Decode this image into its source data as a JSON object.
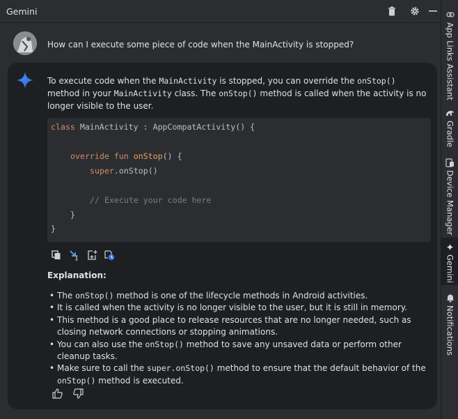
{
  "window": {
    "title": "Gemini",
    "icons": [
      "trash-icon",
      "gear-icon",
      "minimize-icon"
    ]
  },
  "chat": {
    "user_message": "How can I execute some piece of code when the MainActivity is stopped?",
    "intro": {
      "t1": "To execute code when the ",
      "c1": "MainActivity",
      "t2": " is stopped, you can override the ",
      "c2": "onStop()",
      "t3": " method in your ",
      "c3": "MainActivity",
      "t4": " class. The ",
      "c4": "onStop()",
      "t5": " method is called when the activity is no longer visible to the user."
    },
    "code": {
      "l1_kw": "class",
      "l1_name": " MainActivity : AppCompatActivity() {",
      "l3_kw": "override fun",
      "l3_fn": " onStop",
      "l3_rest": "() {",
      "l4_kw": "super",
      "l4_rest": ".onStop()",
      "l6_comment": "// Execute your code here",
      "l7": "}",
      "l8": "}"
    },
    "action_icons": [
      "copy-icon",
      "insert-at-cursor-icon",
      "new-file-icon",
      "history-icon"
    ],
    "explanation_title": "Explanation:",
    "bullets": {
      "b1a": "The ",
      "b1c": "onStop()",
      "b1b": " method is one of the lifecycle methods in Android activities.",
      "b2": "It is called when the activity is no longer visible to the user, but it is still in memory.",
      "b3": "This method is a good place to release resources that are no longer needed, such as closing network connections or stopping animations.",
      "b4a": "You can also use the ",
      "b4c": "onStop()",
      "b4b": " method to save any unsaved data or perform other cleanup tasks.",
      "b5a": "Make sure to call the ",
      "b5c": "super.onStop()",
      "b5b": " method to ensure that the default behavior of the ",
      "b5d": "onStop()",
      "b5e": " method is executed."
    },
    "feedback_icons": [
      "thumbs-up-icon",
      "thumbs-down-icon"
    ]
  },
  "sidebar": {
    "items": [
      {
        "label": "App Links Assistant",
        "icon": "link-icon"
      },
      {
        "label": "Gradle",
        "icon": "gradle-icon"
      },
      {
        "label": "Device Manager",
        "icon": "device-icon"
      },
      {
        "label": "Gemini",
        "icon": "gemini-icon"
      },
      {
        "label": "Notifications",
        "icon": "bell-icon"
      }
    ]
  },
  "colors": {
    "background": "#2b2d30",
    "card": "#1e1f22",
    "keyword": "#cf8e6d",
    "function": "#56a8f5",
    "comment": "#7a7e85",
    "accent": "#3574f0"
  }
}
